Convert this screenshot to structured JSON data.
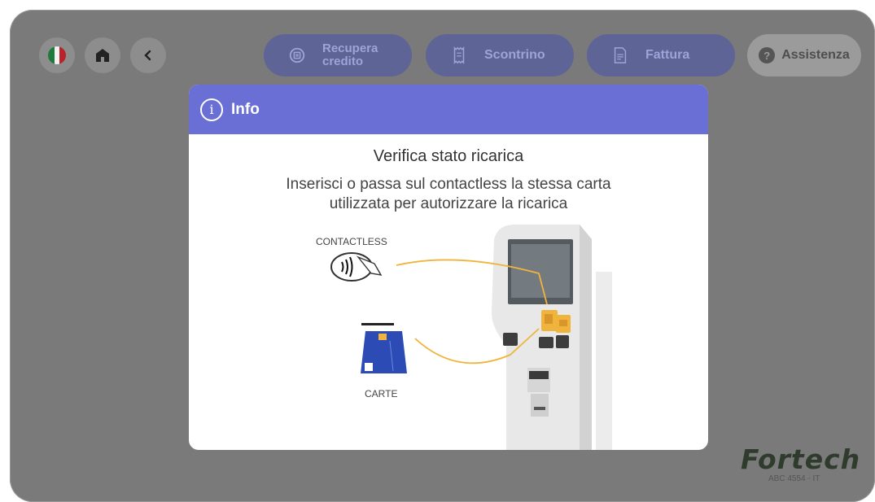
{
  "topbar": {
    "language_icon": "italy-flag-icon",
    "home_icon": "home-icon",
    "back_icon": "chevron-left-icon",
    "recover_label_line1": "Recupera",
    "recover_label_line2": "credito",
    "receipt_label": "Scontrino",
    "invoice_label": "Fattura",
    "assist_label": "Assistenza"
  },
  "modal": {
    "header_title": "Info",
    "heading": "Verifica stato ricarica",
    "body_line1": "Inserisci o passa sul contactless la stessa carta",
    "body_line2": "utilizzata per autorizzare la ricarica",
    "label_contactless": "CONTACTLESS",
    "label_cards": "CARTE"
  },
  "brand": {
    "logo_text": "Fortech",
    "code": "ABC 4554 - IT"
  },
  "colors": {
    "accent": "#6a6fd6",
    "overlay": "#7a7a7a",
    "highlight": "#f0b43c"
  }
}
